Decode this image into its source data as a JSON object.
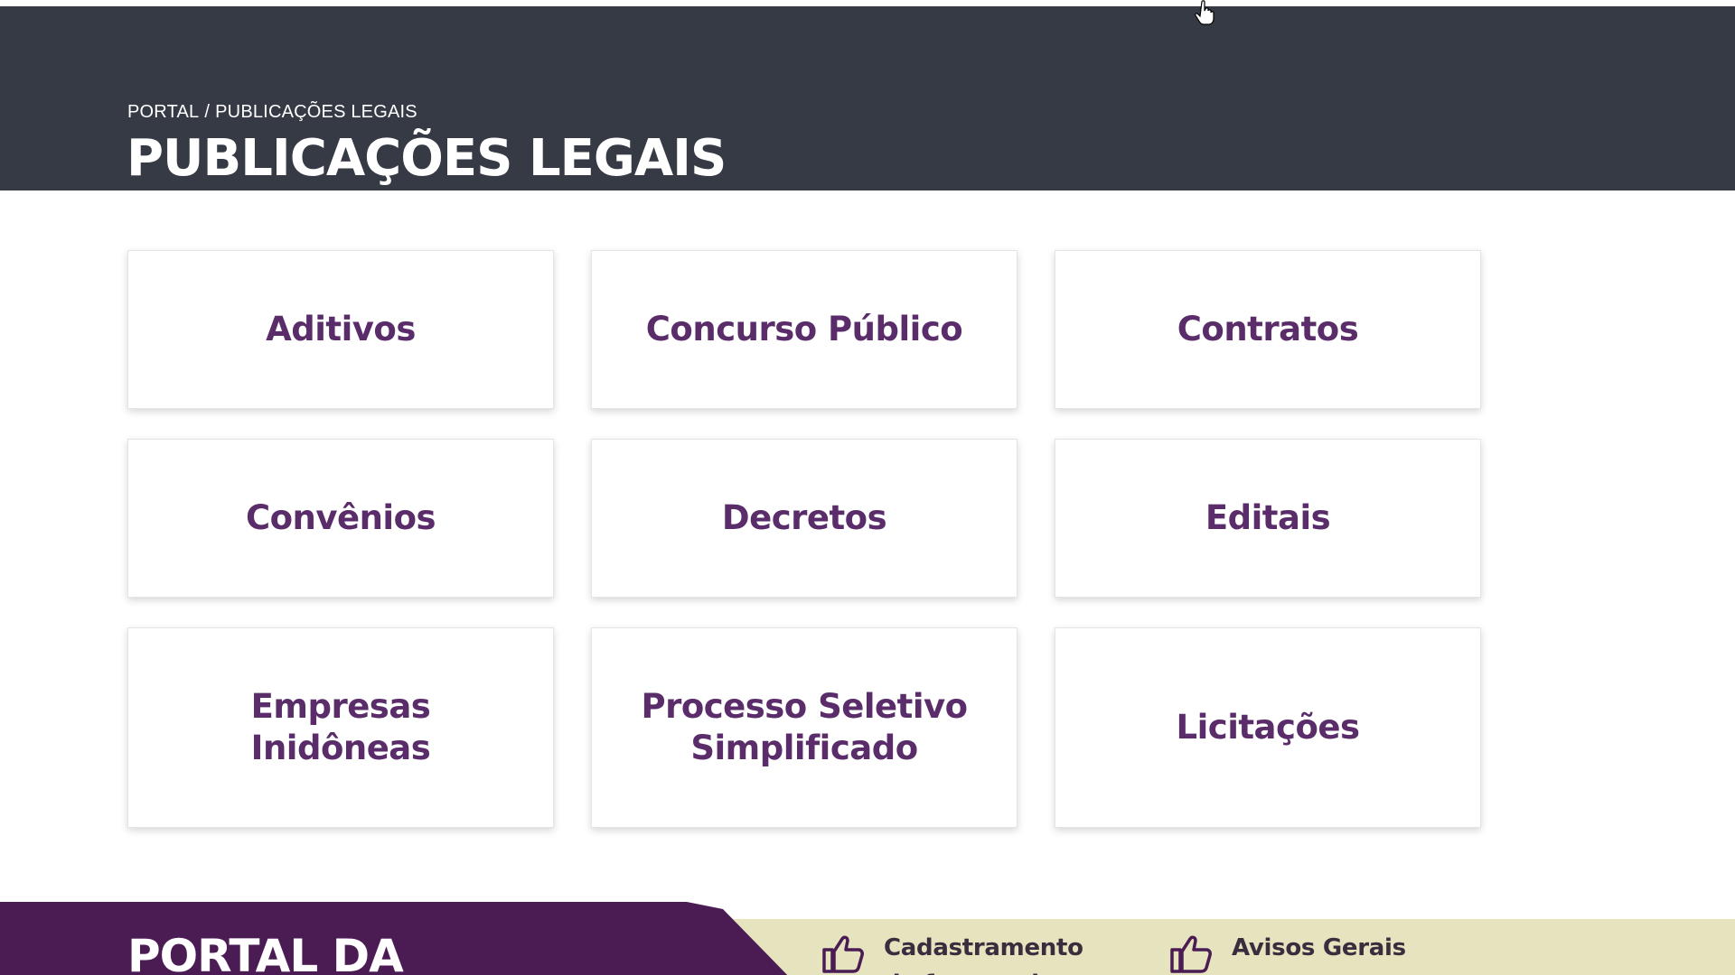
{
  "breadcrumb": {
    "home": "PORTAL",
    "separator": "/",
    "current": "PUBLICAÇÕES LEGAIS"
  },
  "page_title": "PUBLICAÇÕES LEGAIS",
  "categories": [
    "Aditivos",
    "Concurso Público",
    "Contratos",
    "Convênios",
    "Decretos",
    "Editais",
    "Empresas\nInidôneas",
    "Processo Seletivo\nSimplificado",
    "Licitações"
  ],
  "footer": {
    "title": "PORTAL DA",
    "links": [
      {
        "label": "Cadastramento de fornecedores",
        "icon": "thumbs-up-icon"
      },
      {
        "label": "Avisos Gerais",
        "icon": "thumbs-up-icon"
      }
    ]
  },
  "colors": {
    "header_bg": "#363a45",
    "card_text": "#5a2d6a",
    "footer_purple": "#4b1c54",
    "footer_beige": "#e6e3bf"
  }
}
